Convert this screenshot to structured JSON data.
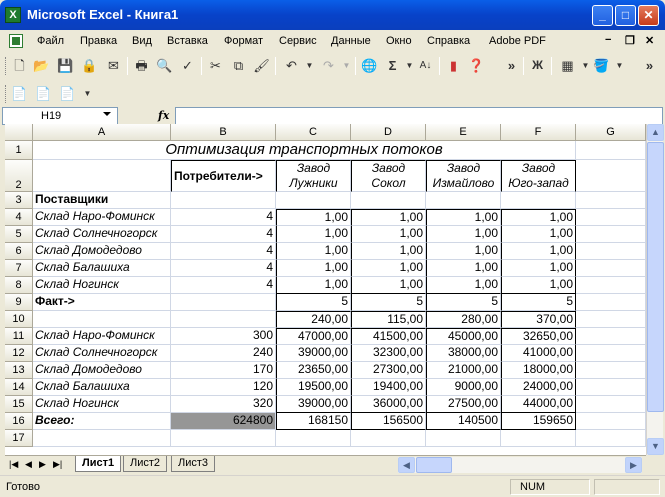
{
  "window": {
    "title": "Microsoft Excel - Книга1"
  },
  "menu": [
    "Файл",
    "Правка",
    "Вид",
    "Вставка",
    "Формат",
    "Сервис",
    "Данные",
    "Окно",
    "Справка",
    "Adobe PDF"
  ],
  "formula_bar": {
    "name_box": "H19",
    "fx": "fx",
    "formula": ""
  },
  "columns": [
    "A",
    "B",
    "C",
    "D",
    "E",
    "F",
    "G"
  ],
  "rows": [
    "1",
    "2",
    "3",
    "4",
    "5",
    "6",
    "7",
    "8",
    "9",
    "10",
    "11",
    "12",
    "13",
    "14",
    "15",
    "16",
    "17"
  ],
  "sheet": {
    "title": "Оптимизация транспортных потоков",
    "consumers_label": "Потребители->",
    "plants": [
      {
        "line1": "Завод",
        "line2": "Лужники"
      },
      {
        "line1": "Завод",
        "line2": "Сокол"
      },
      {
        "line1": "Завод",
        "line2": "Измайлово"
      },
      {
        "line1": "Завод",
        "line2": "Юго-запад"
      }
    ],
    "suppliers_label": "Поставщики",
    "warehouses": [
      "Склад Наро-Фоминск",
      "Склад Солнечногорск",
      "Склад Домодедово",
      "Склад Балашиха",
      "Склад Ногинск"
    ],
    "supply": [
      "4",
      "4",
      "4",
      "4",
      "4"
    ],
    "matrix": [
      [
        "1,00",
        "1,00",
        "1,00",
        "1,00"
      ],
      [
        "1,00",
        "1,00",
        "1,00",
        "1,00"
      ],
      [
        "1,00",
        "1,00",
        "1,00",
        "1,00"
      ],
      [
        "1,00",
        "1,00",
        "1,00",
        "1,00"
      ],
      [
        "1,00",
        "1,00",
        "1,00",
        "1,00"
      ]
    ],
    "fact_label": "Факт->",
    "fact": [
      "5",
      "5",
      "5",
      "5"
    ],
    "row10": [
      "240,00",
      "115,00",
      "280,00",
      "370,00"
    ],
    "warehouses2": [
      "Склад Наро-Фоминск",
      "Склад Солнечногорск",
      "Склад Домодедово",
      "Склад Балашиха",
      "Склад Ногинск"
    ],
    "capacity": [
      "300",
      "240",
      "170",
      "120",
      "320"
    ],
    "costs": [
      [
        "47000,00",
        "41500,00",
        "45000,00",
        "32650,00"
      ],
      [
        "39000,00",
        "32300,00",
        "38000,00",
        "41000,00"
      ],
      [
        "23650,00",
        "27300,00",
        "21000,00",
        "18000,00"
      ],
      [
        "19500,00",
        "19400,00",
        "9000,00",
        "24000,00"
      ],
      [
        "39000,00",
        "36000,00",
        "27500,00",
        "44000,00"
      ]
    ],
    "total_label": "Всего:",
    "total_b": "624800",
    "totals": [
      "168150",
      "156500",
      "140500",
      "159650"
    ]
  },
  "tabs": [
    "Лист1",
    "Лист2",
    "Лист3"
  ],
  "status": {
    "ready": "Готово",
    "num": "NUM"
  }
}
